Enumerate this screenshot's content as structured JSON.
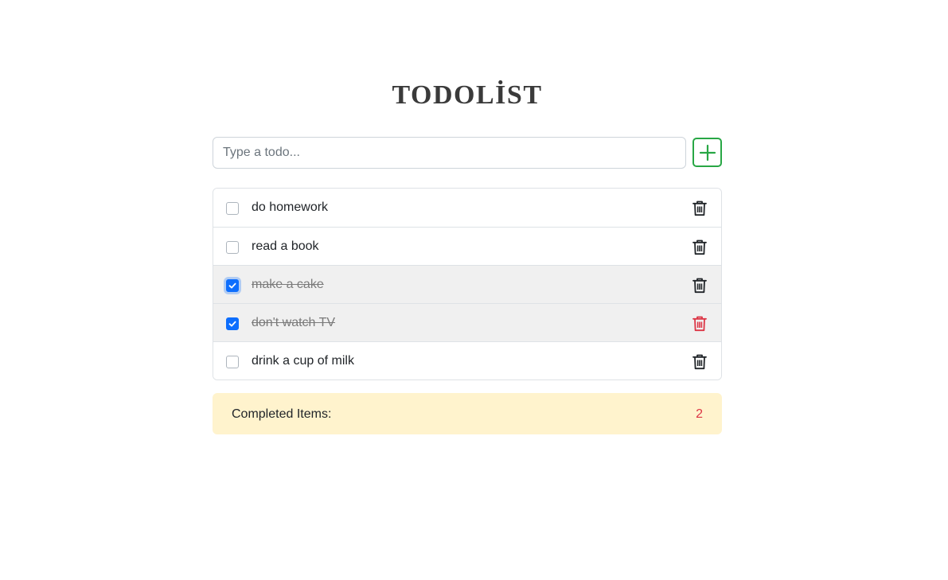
{
  "title": "TODOLİST",
  "input": {
    "placeholder": "Type a todo...",
    "value": ""
  },
  "add_button": {
    "icon": "plus-icon",
    "color": "#28a745"
  },
  "todos": [
    {
      "label": "do homework",
      "completed": false
    },
    {
      "label": "read a book",
      "completed": false
    },
    {
      "label": "make a cake",
      "completed": true
    },
    {
      "label": "don't watch TV",
      "completed": true
    },
    {
      "label": "drink a cup of milk",
      "completed": false
    }
  ],
  "summary": {
    "label": "Completed Items:",
    "count": "2"
  },
  "colors": {
    "accent": "#0d6efd",
    "add": "#28a745",
    "danger": "#dc3545",
    "summary_bg": "#fff3cd",
    "done_bg": "#f0f0f0"
  }
}
